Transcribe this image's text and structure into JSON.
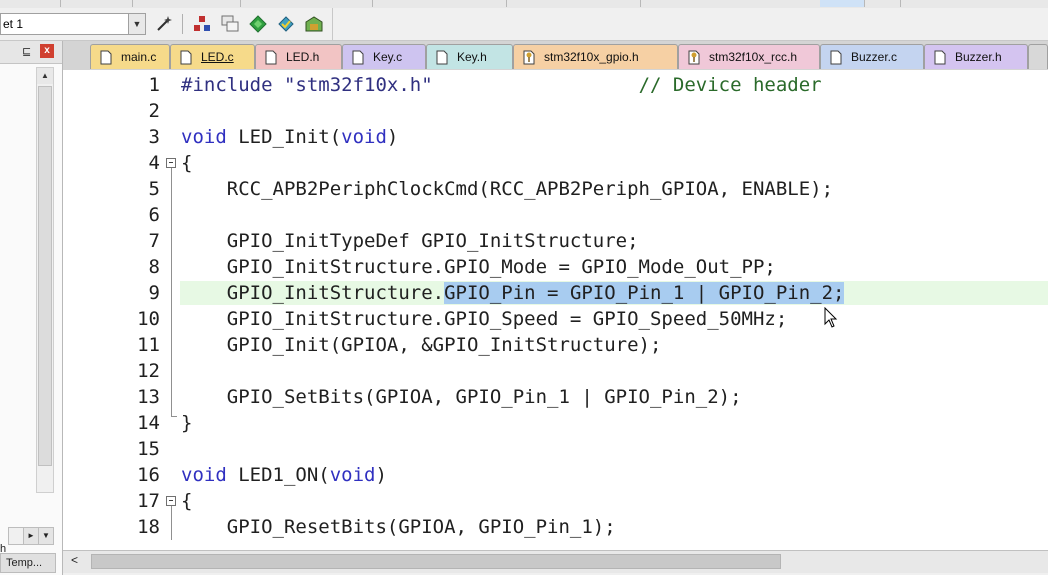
{
  "toolbar": {
    "target_text": "et 1",
    "buttons": [
      "load-icon",
      "download-icon",
      "build-icon",
      "batch-build-icon",
      "options-icon",
      "manage-components-icon"
    ]
  },
  "left_panel": {
    "pin_symbol": "⊑",
    "close_symbol": "x",
    "h_text": "h",
    "tab_label": "Temp..."
  },
  "tabs": [
    {
      "label": "main.c",
      "color": "#f6da8a",
      "icon": "file-icon",
      "active": false
    },
    {
      "label": "LED.c",
      "color": "#f6da8a",
      "icon": "file-icon",
      "active": true
    },
    {
      "label": "LED.h",
      "color": "#f2c4c4",
      "icon": "file-icon",
      "active": false
    },
    {
      "label": "Key.c",
      "color": "#cec4f0",
      "icon": "file-icon",
      "active": false
    },
    {
      "label": "Key.h",
      "color": "#c2e4e4",
      "icon": "file-icon",
      "active": false
    },
    {
      "label": "stm32f10x_gpio.h",
      "color": "#f6d0a4",
      "icon": "header-file-icon",
      "active": false
    },
    {
      "label": "stm32f10x_rcc.h",
      "color": "#f0c8d8",
      "icon": "header-file-icon",
      "active": false
    },
    {
      "label": "Buzzer.c",
      "color": "#c4d4f0",
      "icon": "file-icon",
      "active": false
    },
    {
      "label": "Buzzer.h",
      "color": "#d4c4f0",
      "icon": "file-icon",
      "active": false
    }
  ],
  "code": {
    "highlight_line": 9,
    "lines": [
      {
        "n": "1",
        "fold": "",
        "segs": [
          {
            "t": "#include \"stm32f10x.h\"",
            "c": "str"
          },
          {
            "t": "                  // Device header",
            "c": "com"
          }
        ]
      },
      {
        "n": "2",
        "fold": "",
        "segs": []
      },
      {
        "n": "3",
        "fold": "",
        "segs": [
          {
            "t": "void",
            "c": "kw"
          },
          {
            "t": " LED_Init(",
            "c": ""
          },
          {
            "t": "void",
            "c": "kw"
          },
          {
            "t": ")",
            "c": ""
          }
        ]
      },
      {
        "n": "4",
        "fold": "open",
        "segs": [
          {
            "t": "{",
            "c": ""
          }
        ]
      },
      {
        "n": "5",
        "fold": "",
        "segs": [
          {
            "t": "    RCC_APB2PeriphClockCmd(RCC_APB2Periph_GPIOA, ENABLE);",
            "c": ""
          }
        ]
      },
      {
        "n": "6",
        "fold": "",
        "segs": []
      },
      {
        "n": "7",
        "fold": "",
        "segs": [
          {
            "t": "    GPIO_InitTypeDef GPIO_InitStructure;",
            "c": ""
          }
        ]
      },
      {
        "n": "8",
        "fold": "",
        "segs": [
          {
            "t": "    GPIO_InitStructure.GPIO_Mode = GPIO_Mode_Out_PP;",
            "c": ""
          }
        ]
      },
      {
        "n": "9",
        "fold": "",
        "segs": [
          {
            "t": "    GPIO_InitStructure.",
            "c": ""
          },
          {
            "t": "GPIO_Pin = GPIO_Pin_1 | GPIO_Pin_2;",
            "c": "sel"
          }
        ]
      },
      {
        "n": "10",
        "fold": "",
        "segs": [
          {
            "t": "    GPIO_InitStructure.GPIO_Speed = GPIO_Speed_50MHz;",
            "c": ""
          }
        ]
      },
      {
        "n": "11",
        "fold": "",
        "segs": [
          {
            "t": "    GPIO_Init(GPIOA, &GPIO_InitStructure);",
            "c": ""
          }
        ]
      },
      {
        "n": "12",
        "fold": "",
        "segs": []
      },
      {
        "n": "13",
        "fold": "",
        "segs": [
          {
            "t": "    GPIO_SetBits(GPIOA, GPIO_Pin_1 | GPIO_Pin_2);",
            "c": ""
          }
        ]
      },
      {
        "n": "14",
        "fold": "",
        "segs": [
          {
            "t": "}",
            "c": ""
          }
        ]
      },
      {
        "n": "15",
        "fold": "end",
        "segs": []
      },
      {
        "n": "16",
        "fold": "",
        "segs": [
          {
            "t": "void",
            "c": "kw"
          },
          {
            "t": " LED1_ON(",
            "c": ""
          },
          {
            "t": "void",
            "c": "kw"
          },
          {
            "t": ")",
            "c": ""
          }
        ]
      },
      {
        "n": "17",
        "fold": "open",
        "segs": [
          {
            "t": "{",
            "c": ""
          }
        ]
      },
      {
        "n": "18",
        "fold": "",
        "segs": [
          {
            "t": "    GPIO_ResetBits(GPIOA, GPIO_Pin_1);",
            "c": ""
          }
        ]
      }
    ]
  }
}
